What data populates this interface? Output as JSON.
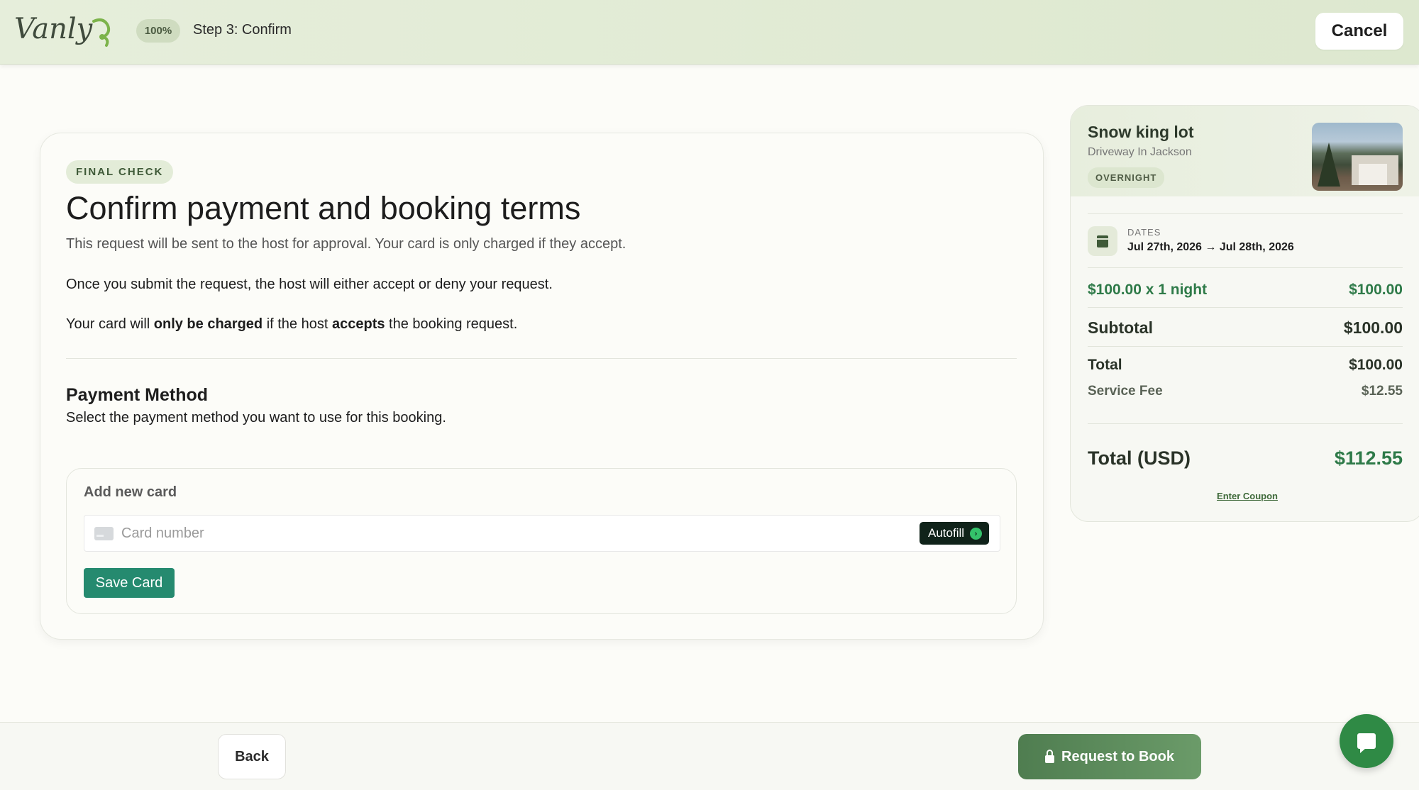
{
  "header": {
    "logo_text": "Vanly",
    "progress": "100%",
    "step": "Step 3: Confirm",
    "cancel_label": "Cancel"
  },
  "main": {
    "badge": "FINAL CHECK",
    "title": "Confirm payment and booking terms",
    "subtitle": "This request will be sent to the host for approval. Your card is only charged if they accept.",
    "info_line_1": "Once you submit the request, the host will either accept or deny your request.",
    "info_line_2": {
      "part1": "Your card will ",
      "bold1": "only be charged",
      "part2": " if the host ",
      "bold2": "accepts",
      "part3": " the booking request."
    },
    "payment_method": {
      "title": "Payment Method",
      "description": "Select the payment method you want to use for this booking.",
      "add_card_label": "Add new card",
      "card_placeholder": "Card number",
      "autofill_label": "Autofill",
      "save_card_label": "Save Card"
    }
  },
  "sidebar": {
    "listing_name": "Snow king lot",
    "listing_sub": "Driveway In Jackson",
    "listing_tag": "OVERNIGHT",
    "dates_label": "DATES",
    "dates_value": "Jul 27th, 2026 → Jul 28th, 2026",
    "nightly_label": "$100.00 x 1 night",
    "nightly_amount": "$100.00",
    "subtotal_label": "Subtotal",
    "subtotal_amount": "$100.00",
    "total_label": "Total",
    "total_amount": "$100.00",
    "fee_label": "Service Fee",
    "fee_amount": "$12.55",
    "grand_label": "Total (USD)",
    "grand_amount": "$112.55",
    "coupon_label": "Enter Coupon"
  },
  "footer": {
    "back_label": "Back",
    "book_label": "Request to Book"
  },
  "icons": {
    "logo": "vanly-logo",
    "card": "credit-card-icon",
    "autofill": "arrow-circle-icon",
    "calendar": "calendar-icon",
    "lock": "lock-icon",
    "chat": "chat-icon"
  },
  "colors": {
    "accent_green": "#2e7a48",
    "save_button": "#258a6f",
    "header_bg": "#e6eedb"
  }
}
